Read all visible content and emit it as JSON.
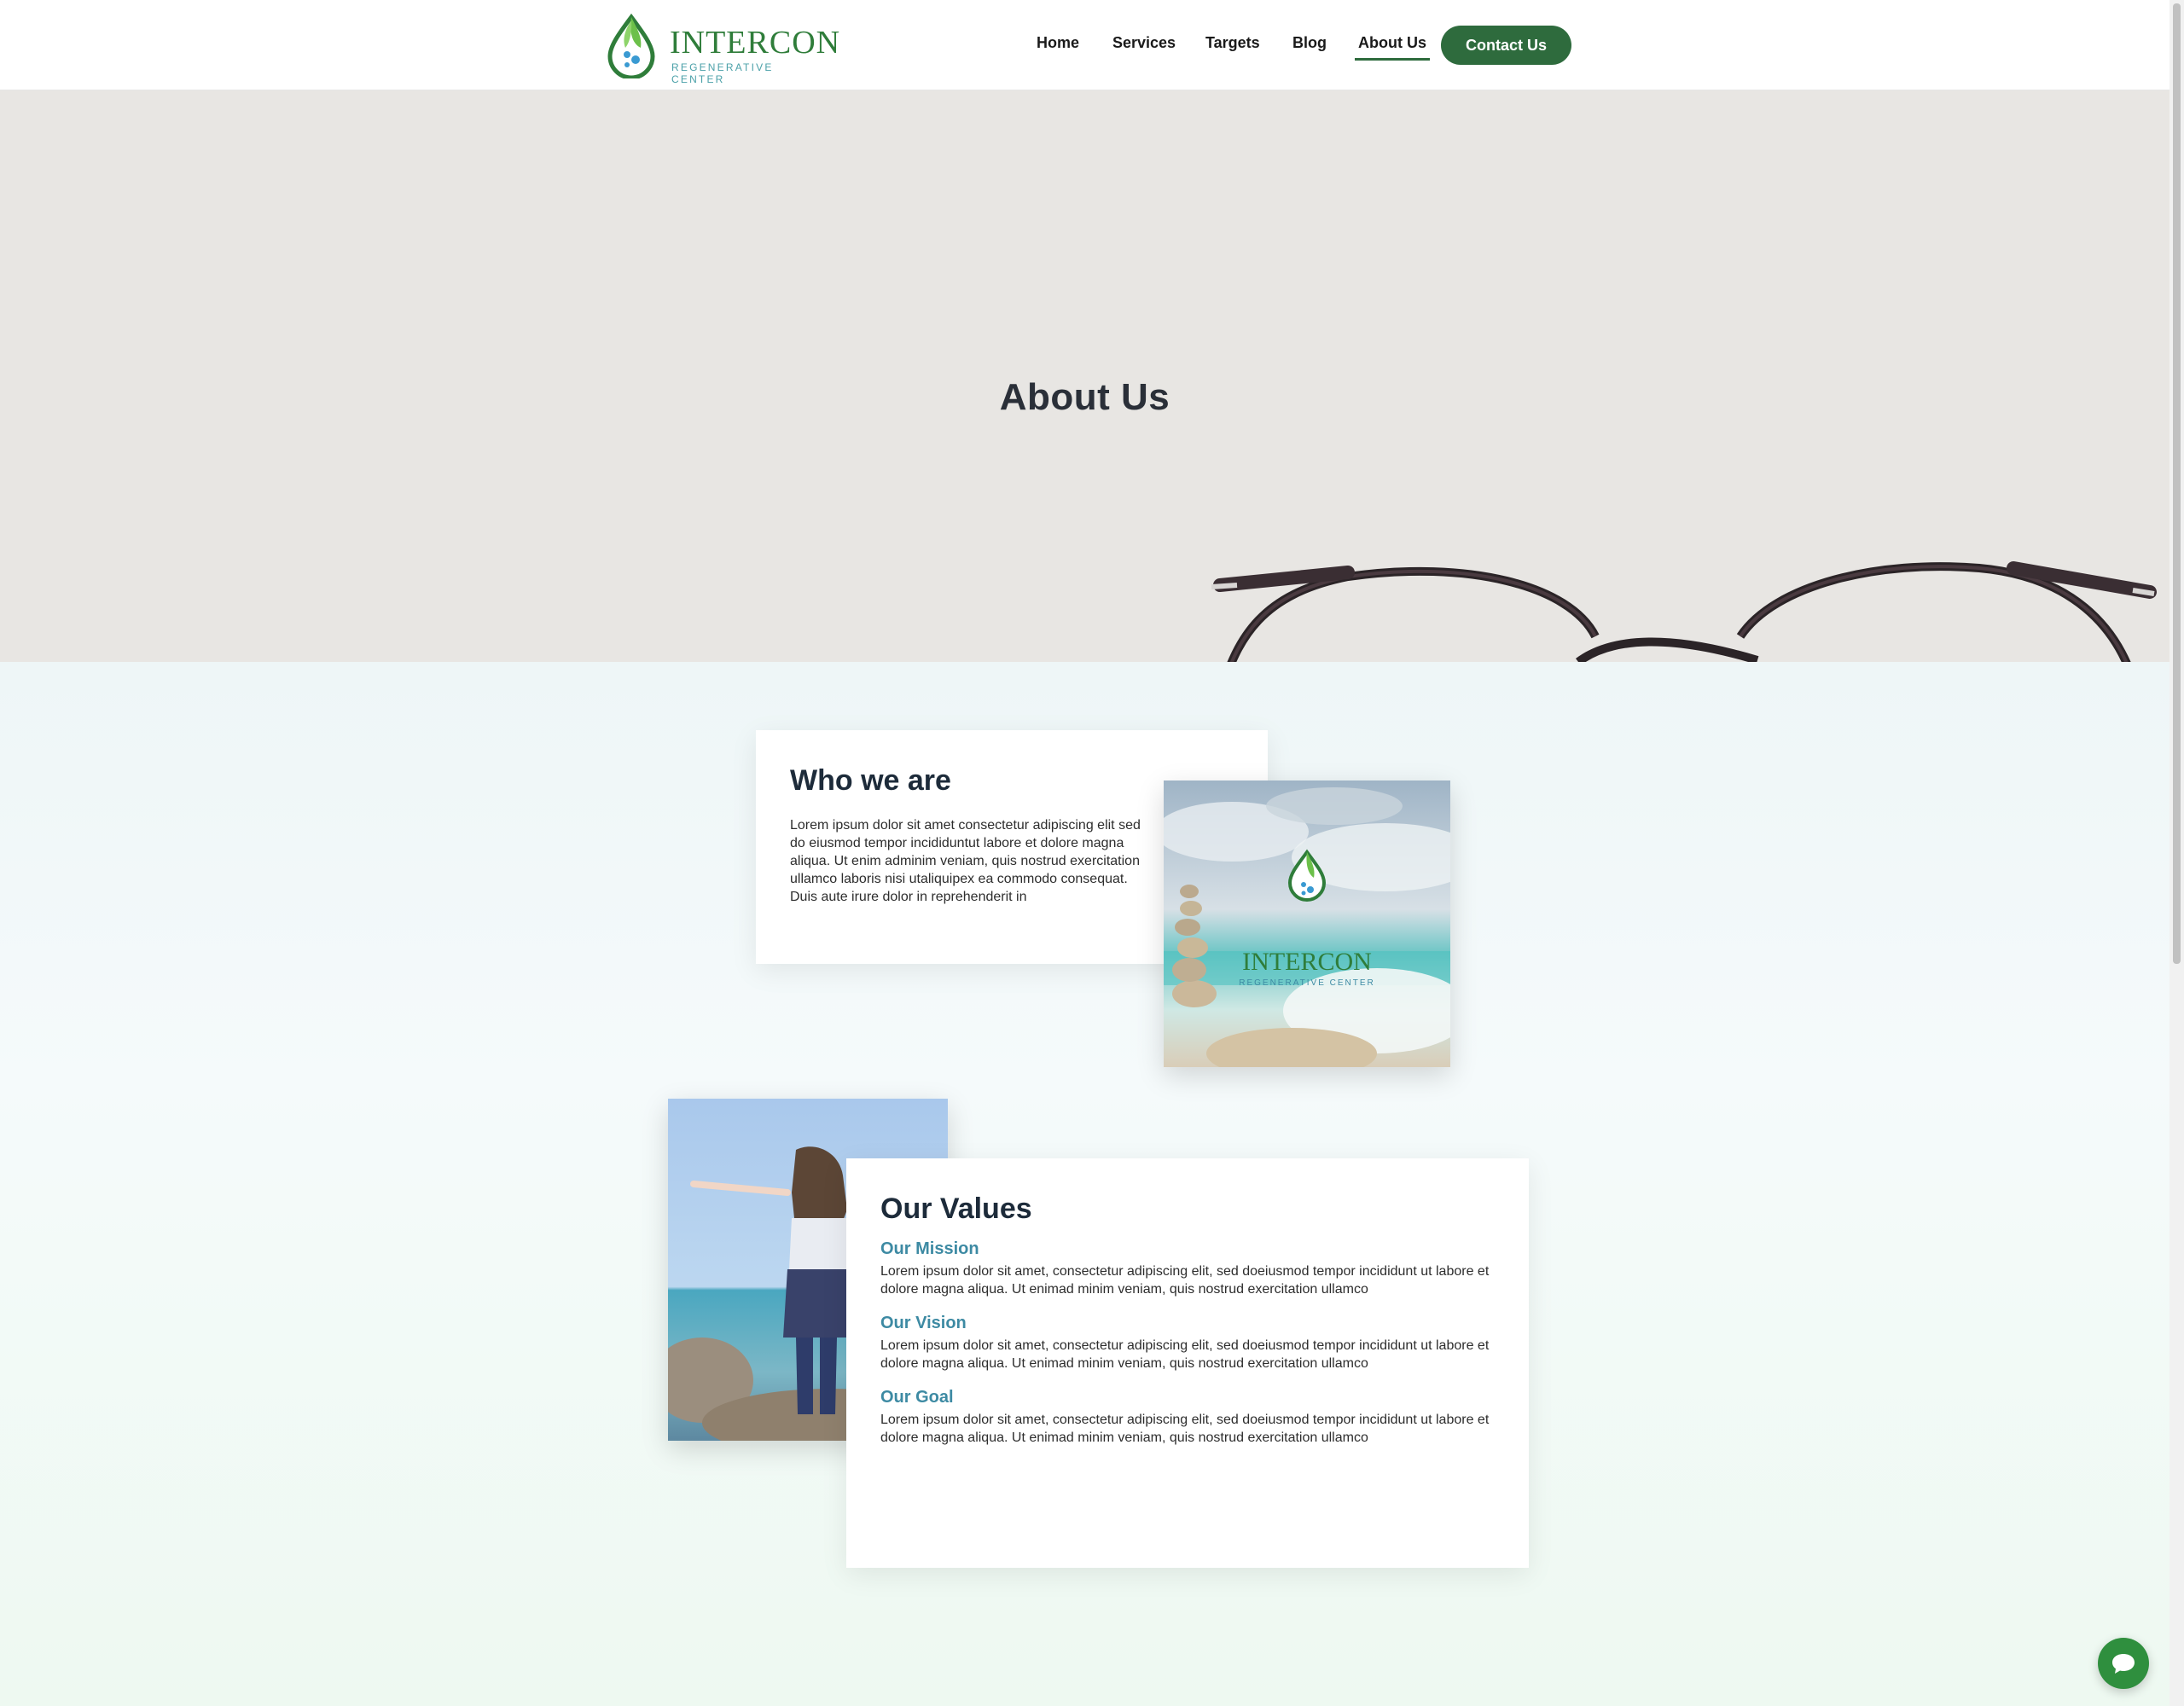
{
  "header": {
    "logo": {
      "name": "INTERCON",
      "tagline": "REGENERATIVE CENTER"
    },
    "nav": [
      {
        "label": "Home",
        "active": false
      },
      {
        "label": "Services",
        "active": false
      },
      {
        "label": "Targets",
        "active": false
      },
      {
        "label": "Blog",
        "active": false
      },
      {
        "label": "About Us",
        "active": true
      }
    ],
    "contact_label": "Contact Us"
  },
  "hero": {
    "title": "About Us"
  },
  "who": {
    "title": "Who we are",
    "text": "Lorem ipsum dolor sit amet consectetur adipiscing elit sed do eiusmod tempor incididuntut labore et dolore magna aliqua. Ut enim adminim veniam, quis nostrud exercitation ullamco laboris nisi utaliquipex ea commodo consequat. Duis aute irure dolor in reprehenderit in",
    "image_logo": {
      "name": "INTERCON",
      "tagline": "REGENERATIVE CENTER"
    }
  },
  "values": {
    "title": "Our Values",
    "items": [
      {
        "title": "Our Mission",
        "text": "Lorem ipsum dolor sit amet, consectetur adipiscing elit, sed doeiusmod tempor incididunt ut labore et dolore magna aliqua. Ut enimad minim veniam, quis nostrud exercitation ullamco"
      },
      {
        "title": "Our Vision",
        "text": "Lorem ipsum dolor sit amet, consectetur adipiscing elit, sed doeiusmod tempor incididunt ut labore et dolore magna aliqua. Ut enimad minim veniam, quis nostrud exercitation ullamco"
      },
      {
        "title": "Our Goal",
        "text": "Lorem ipsum dolor sit amet, consectetur adipiscing elit, sed doeiusmod tempor incididunt ut labore et dolore magna aliqua. Ut enimad minim veniam, quis nostrud exercitation ullamco"
      }
    ]
  },
  "colors": {
    "brand_green": "#2e6b3d",
    "accent_blue": "#3d8aa3",
    "hero_bg": "#e8e6e3"
  },
  "icons": {
    "chat": "chat-bubble-icon"
  }
}
